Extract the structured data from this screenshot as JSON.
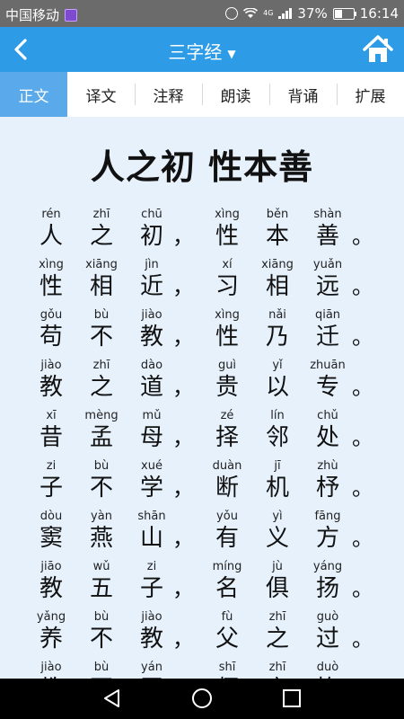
{
  "status_bar": {
    "carrier": "中国移动",
    "battery": "37%",
    "battery_level": 0.37,
    "time": "16:14",
    "network": "4G"
  },
  "app_bar": {
    "title": "三字经",
    "back_icon": "chevron-left-icon",
    "dropdown_icon": "caret-down-icon",
    "home_icon": "home-icon"
  },
  "tabs": [
    {
      "label": "正文",
      "active": true
    },
    {
      "label": "译文",
      "active": false
    },
    {
      "label": "注释",
      "active": false
    },
    {
      "label": "朗读",
      "active": false
    },
    {
      "label": "背诵",
      "active": false
    },
    {
      "label": "扩展",
      "active": false
    }
  ],
  "heading": "人之初 性本善",
  "lines": [
    {
      "a": [
        {
          "py": "rén",
          "hz": "人"
        },
        {
          "py": "zhī",
          "hz": "之"
        },
        {
          "py": "chū",
          "hz": "初"
        }
      ],
      "p1": "，",
      "b": [
        {
          "py": "xìng",
          "hz": "性"
        },
        {
          "py": "běn",
          "hz": "本"
        },
        {
          "py": "shàn",
          "hz": "善"
        }
      ],
      "p2": "。"
    },
    {
      "a": [
        {
          "py": "xìng",
          "hz": "性"
        },
        {
          "py": "xiāng",
          "hz": "相"
        },
        {
          "py": "jìn",
          "hz": "近"
        }
      ],
      "p1": "，",
      "b": [
        {
          "py": "xí",
          "hz": "习"
        },
        {
          "py": "xiāng",
          "hz": "相"
        },
        {
          "py": "yuǎn",
          "hz": "远"
        }
      ],
      "p2": "。"
    },
    {
      "a": [
        {
          "py": "gǒu",
          "hz": "苟"
        },
        {
          "py": "bù",
          "hz": "不"
        },
        {
          "py": "jiào",
          "hz": "教"
        }
      ],
      "p1": "，",
      "b": [
        {
          "py": "xìng",
          "hz": "性"
        },
        {
          "py": "nǎi",
          "hz": "乃"
        },
        {
          "py": "qiān",
          "hz": "迁"
        }
      ],
      "p2": "。"
    },
    {
      "a": [
        {
          "py": "jiào",
          "hz": "教"
        },
        {
          "py": "zhī",
          "hz": "之"
        },
        {
          "py": "dào",
          "hz": "道"
        }
      ],
      "p1": "，",
      "b": [
        {
          "py": "guì",
          "hz": "贵"
        },
        {
          "py": "yǐ",
          "hz": "以"
        },
        {
          "py": "zhuān",
          "hz": "专"
        }
      ],
      "p2": "。"
    },
    {
      "a": [
        {
          "py": "xī",
          "hz": "昔"
        },
        {
          "py": "mèng",
          "hz": "孟"
        },
        {
          "py": "mǔ",
          "hz": "母"
        }
      ],
      "p1": "，",
      "b": [
        {
          "py": "zé",
          "hz": "择"
        },
        {
          "py": "lín",
          "hz": "邻"
        },
        {
          "py": "chǔ",
          "hz": "处"
        }
      ],
      "p2": "。"
    },
    {
      "a": [
        {
          "py": "zi",
          "hz": "子"
        },
        {
          "py": "bù",
          "hz": "不"
        },
        {
          "py": "xué",
          "hz": "学"
        }
      ],
      "p1": "，",
      "b": [
        {
          "py": "duàn",
          "hz": "断"
        },
        {
          "py": "jī",
          "hz": "机"
        },
        {
          "py": "zhù",
          "hz": "杼"
        }
      ],
      "p2": "。"
    },
    {
      "a": [
        {
          "py": "dòu",
          "hz": "窦"
        },
        {
          "py": "yàn",
          "hz": "燕"
        },
        {
          "py": "shān",
          "hz": "山"
        }
      ],
      "p1": "，",
      "b": [
        {
          "py": "yǒu",
          "hz": "有"
        },
        {
          "py": "yì",
          "hz": "义"
        },
        {
          "py": "fāng",
          "hz": "方"
        }
      ],
      "p2": "。"
    },
    {
      "a": [
        {
          "py": "jiāo",
          "hz": "教"
        },
        {
          "py": "wǔ",
          "hz": "五"
        },
        {
          "py": "zi",
          "hz": "子"
        }
      ],
      "p1": "，",
      "b": [
        {
          "py": "míng",
          "hz": "名"
        },
        {
          "py": "jù",
          "hz": "俱"
        },
        {
          "py": "yáng",
          "hz": "扬"
        }
      ],
      "p2": "。"
    },
    {
      "a": [
        {
          "py": "yǎng",
          "hz": "养"
        },
        {
          "py": "bù",
          "hz": "不"
        },
        {
          "py": "jiào",
          "hz": "教"
        }
      ],
      "p1": "，",
      "b": [
        {
          "py": "fù",
          "hz": "父"
        },
        {
          "py": "zhī",
          "hz": "之"
        },
        {
          "py": "guò",
          "hz": "过"
        }
      ],
      "p2": "。"
    },
    {
      "a": [
        {
          "py": "jiào",
          "hz": "教"
        },
        {
          "py": "bù",
          "hz": "不"
        },
        {
          "py": "yán",
          "hz": "严"
        }
      ],
      "p1": "，",
      "b": [
        {
          "py": "shī",
          "hz": "师"
        },
        {
          "py": "zhī",
          "hz": "之"
        },
        {
          "py": "duò",
          "hz": "惰"
        }
      ],
      "p2": "。"
    }
  ],
  "nav_bar": {
    "back_icon": "triangle-back-icon",
    "home_icon": "circle-home-icon",
    "recents_icon": "square-recents-icon"
  },
  "colors": {
    "app_bar": "#2e9be6",
    "tab_active": "#5aa9ea",
    "content_bg": "#e6f1fc",
    "status_bar": "#6b6b6b"
  }
}
